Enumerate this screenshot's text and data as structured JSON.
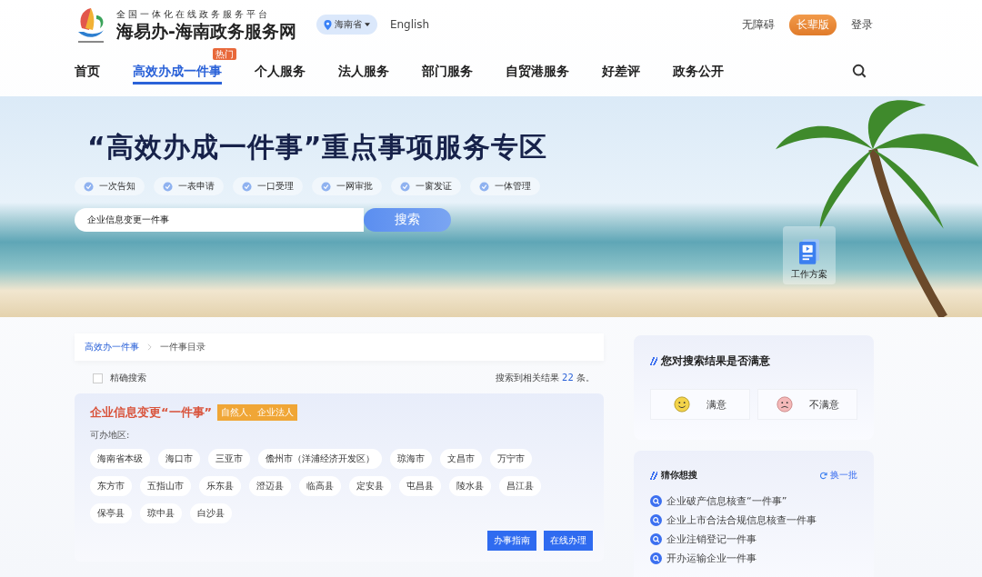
{
  "header": {
    "logo_caption": "全国一体化在线政务服务平台",
    "site_title": "海易办-海南政务服务网",
    "region": "海南省",
    "language": "English",
    "links": [
      {
        "label": "无障碍",
        "kind": "link"
      },
      {
        "label": "长辈版",
        "kind": "pill"
      },
      {
        "label": "登录",
        "kind": "link"
      }
    ]
  },
  "nav": [
    {
      "label": "首页",
      "selected": false
    },
    {
      "label": "高效办成一件事",
      "selected": true,
      "badge": "热门"
    },
    {
      "label": "个人服务",
      "selected": false
    },
    {
      "label": "法人服务",
      "selected": false
    },
    {
      "label": "部门服务",
      "selected": false
    },
    {
      "label": "自贸港服务",
      "selected": false
    },
    {
      "label": "好差评",
      "selected": false
    },
    {
      "label": "政务公开",
      "selected": false
    }
  ],
  "hero": {
    "title": "“高效办成一件事”重点事项服务专区",
    "features": [
      "一次告知",
      "一表申请",
      "一口受理",
      "一网审批",
      "一窗发证",
      "一体管理"
    ],
    "search_value": "企业信息变更一件事",
    "search_button": "搜索",
    "plan_label": "工作方案"
  },
  "breadcrumb": [
    {
      "label": "高效办一件事",
      "kind": "link"
    },
    {
      "label": "一件事目录",
      "kind": "current"
    }
  ],
  "filter": {
    "exact_label": "精确搜索",
    "checked": false,
    "result_prefix": "搜索到相关结果",
    "result_count": "22",
    "result_suffix": "条。"
  },
  "result": {
    "title": "企业信息变更“一件事”",
    "tag": "自然人、企业法人",
    "regions_label": "可办地区:",
    "regions": [
      "海南省本级",
      "海口市",
      "三亚市",
      "儋州市（洋浦经济开发区）",
      "琼海市",
      "文昌市",
      "万宁市",
      "东方市",
      "五指山市",
      "乐东县",
      "澄迈县",
      "临高县",
      "定安县",
      "屯昌县",
      "陵水县",
      "昌江县",
      "保亭县",
      "琼中县",
      "白沙县"
    ],
    "buttons": [
      "办事指南",
      "在线办理"
    ]
  },
  "satisfaction": {
    "title": "您对搜索结果是否满意",
    "options": [
      {
        "label": "满意",
        "kind": "happy"
      },
      {
        "label": "不满意",
        "kind": "sad"
      }
    ]
  },
  "suggestions": {
    "title": "猜你想搜",
    "refresh": "换一批",
    "items": [
      "企业破产信息核查“一件事”",
      "企业上市合法合规信息核查一件事",
      "企业注销登记一件事",
      "开办运输企业一件事"
    ]
  }
}
